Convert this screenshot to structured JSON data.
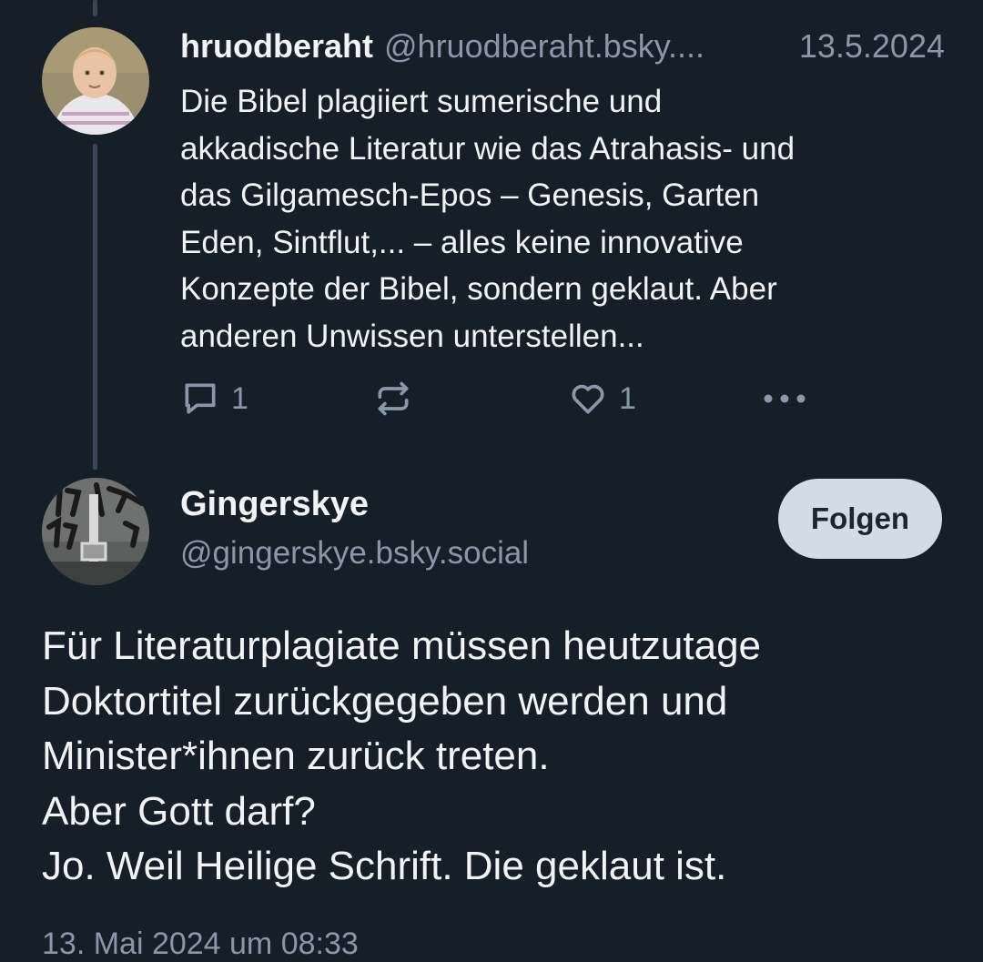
{
  "reply_post": {
    "display_name": "hruodberaht",
    "handle": "@hruodberaht.bsky....",
    "date": "13.5.2024",
    "text_lines": [
      "Die Bibel plagiiert sumerische und",
      "akkadische Literatur wie das Atrahasis- und",
      "das Gilgamesch-Epos – Genesis, Garten",
      "Eden, Sintflut,... – alles keine innovative",
      "Konzepte der Bibel, sondern geklaut. Aber",
      "anderen Unwissen unterstellen..."
    ],
    "actions": {
      "reply_count": "1",
      "like_count": "1"
    }
  },
  "main_post": {
    "display_name": "Gingerskye",
    "handle": "@gingerskye.bsky.social",
    "follow_label": "Folgen",
    "text_lines": [
      "Für Literaturplagiate müssen heutzutage",
      "Doktortitel zurückgegeben werden und",
      "Minister*ihnen zurück treten.",
      "Aber Gott darf?",
      "Jo. Weil Heilige Schrift. Die geklaut ist."
    ],
    "timestamp": "13. Mai 2024 um 08:33"
  },
  "icons": {
    "reply": "speech-bubble-icon",
    "repost": "repost-arrows-icon",
    "like": "heart-icon",
    "more": "ellipsis-icon"
  },
  "colors": {
    "background": "#161e27",
    "text": "#f1f3f5",
    "muted": "#8a97a8",
    "thread_line": "#3b4654",
    "follow_button": "#d3dbe5"
  }
}
